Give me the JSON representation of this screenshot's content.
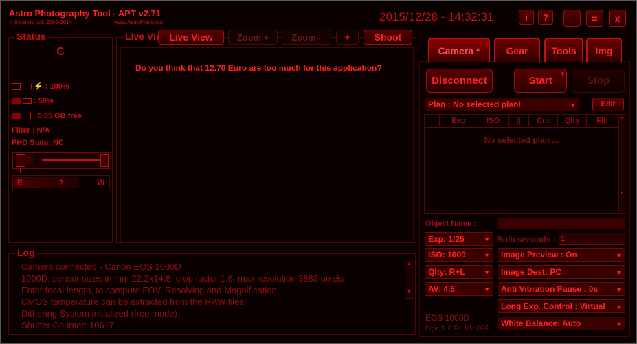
{
  "app": {
    "title": "Astro Photography Tool - APT v2.71",
    "copyright": "© Incanus Ltd. 2009-2014",
    "website": "www.AstroPlace.net",
    "datetime": "2015/12/28 - 14:32:31"
  },
  "window_buttons": {
    "info": "i",
    "help": "?",
    "minimize": "_",
    "maximize": "=",
    "close": "x"
  },
  "status": {
    "legend": "Status",
    "letter": "C",
    "battery": ": 100%",
    "battery2": ": 50%",
    "storage": ": 5.65 GB free",
    "filter": "Filter : N/A",
    "phd": "PHD State: NC",
    "focus_e": "E",
    "focus_q": "?",
    "focus_w": "W"
  },
  "liveview": {
    "legend": "Live View",
    "live_view_btn": "Live View",
    "zoom_in": "Zoom +",
    "zoom_out": "Zoom -",
    "shoot": "Shoot",
    "message": "Do you think that 12.70 Euro are too much for this application?"
  },
  "log": {
    "legend": "Log",
    "lines": [
      "Camera connected - Canon EOS 1000D",
      "1000D, sensor sizes in mm 22.2x14.8, crop factor 1.6, max resolution 3888 pixels",
      "Enter focal length, to compute FOV, Resolving and Magnification",
      "CMOS temperature can be extracted from the RAW files!",
      "Dithering System initialized (free mode).",
      "Shutter Counter: 10617"
    ]
  },
  "tabs": [
    "Camera *",
    "Gear",
    "Tools",
    "Img"
  ],
  "camera": {
    "disconnect": "Disconnect",
    "start": "Start",
    "start_sup": "+",
    "stop": "Stop",
    "plan": "Plan : No selected plan!",
    "edit": "Edit",
    "columns": [
      "Exp",
      "ISO",
      "||",
      "Cnt",
      "Qlty",
      "Fltr"
    ],
    "empty_plan": "No selected plan ...",
    "object_name_label": "Object Name :",
    "object_name_value": "",
    "exp": "Exp: 1/25",
    "bulb_label": "Bulb seconds :",
    "bulb_value": "1",
    "iso": "ISO: 1600",
    "image_preview": "Image Preview : On",
    "quality": "Qlty: R+L",
    "image_dest": "Image Dest: PC",
    "av": "AV: 4.5",
    "anti_vibration": "Anti Vibration Pause : 0s",
    "long_exp": "Long Exp. Control : Virtual",
    "white_balance": "White Balance: Auto",
    "model": "EOS 1000D",
    "model_info": "Digic 3, C.Fn. ML: OFF"
  }
}
